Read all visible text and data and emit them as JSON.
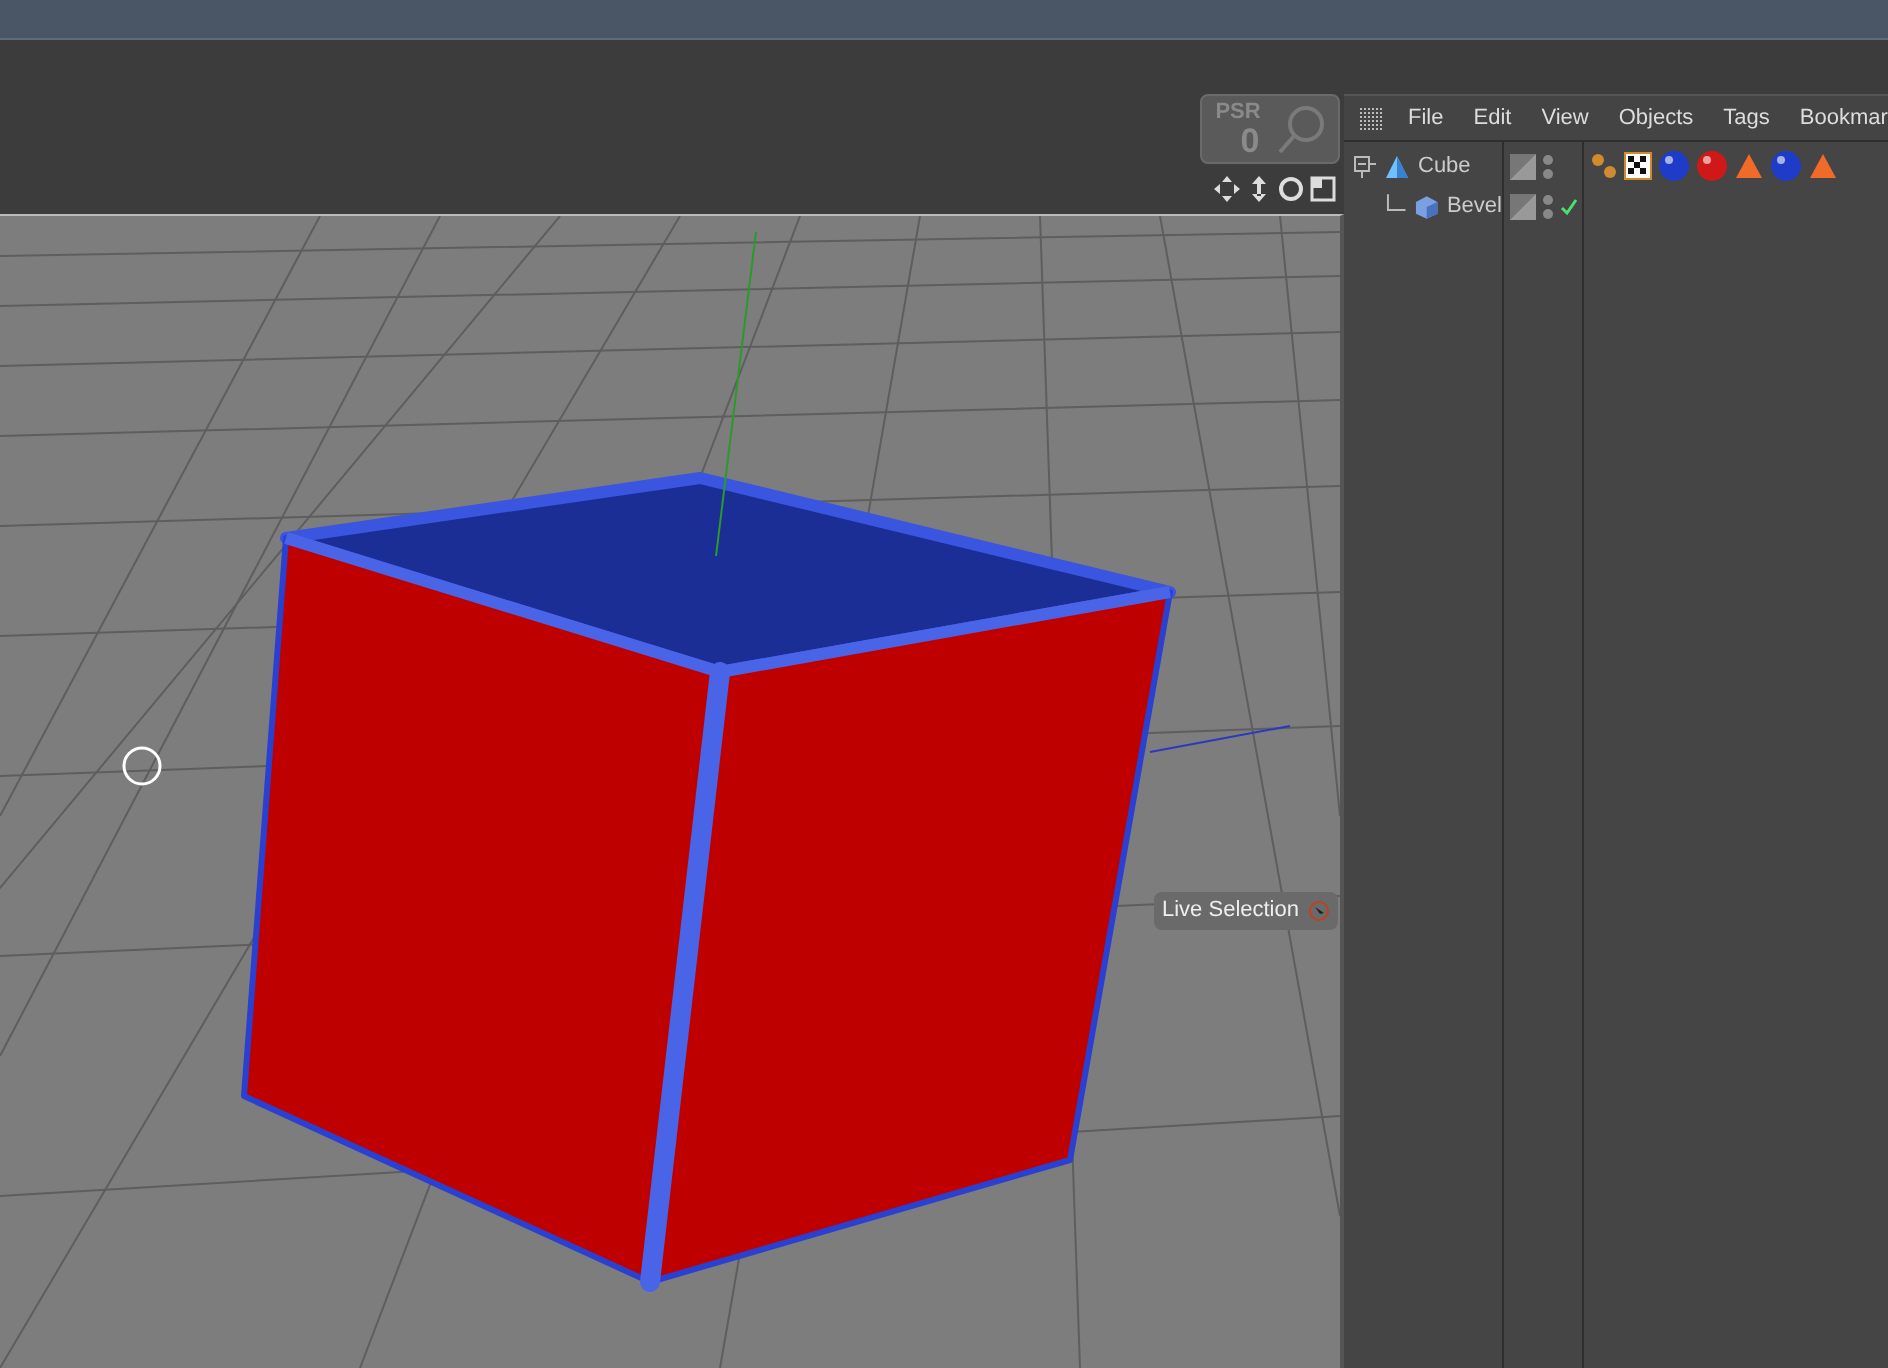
{
  "psr_badge": {
    "label": "PSR",
    "value": "0"
  },
  "viewport": {
    "tool_label": "Live Selection"
  },
  "object_manager": {
    "menu": [
      "File",
      "Edit",
      "View",
      "Objects",
      "Tags",
      "Bookmar"
    ],
    "objects": [
      {
        "name": "Cube",
        "kind": "primitive",
        "check": false,
        "tags": [
          {
            "kind": "dots"
          },
          {
            "kind": "checker"
          },
          {
            "kind": "sphere",
            "color": "#1f3cc8"
          },
          {
            "kind": "sphere",
            "color": "#d01818"
          },
          {
            "kind": "cone"
          },
          {
            "kind": "sphere",
            "color": "#1f3cc8"
          },
          {
            "kind": "cone"
          }
        ],
        "children": [
          {
            "name": "Bevel",
            "kind": "deformer",
            "check": true
          }
        ]
      }
    ]
  }
}
